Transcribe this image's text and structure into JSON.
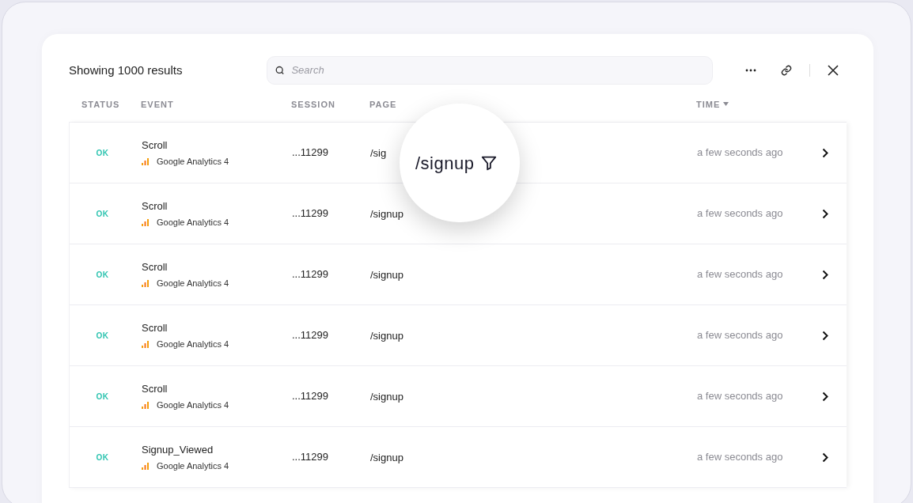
{
  "header": {
    "title": "Showing 1000 results",
    "search": {
      "placeholder": "Search"
    }
  },
  "columns": [
    {
      "label": "STATUS",
      "sorted": false
    },
    {
      "label": "EVENT",
      "sorted": false
    },
    {
      "label": "SESSION",
      "sorted": false
    },
    {
      "label": "PAGE",
      "sorted": false
    },
    {
      "label": "TIME",
      "sorted": true
    }
  ],
  "rows": [
    {
      "status": {
        "label": "OK",
        "kind": "ok"
      },
      "event": "Scroll",
      "source": "Google Analytics 4",
      "session": "...11299",
      "page": "/sig",
      "time": "a few seconds ago"
    },
    {
      "status": {
        "label": "OK",
        "kind": "ok"
      },
      "event": "Scroll",
      "source": "Google Analytics 4",
      "session": "...11299",
      "page": "/signup",
      "time": "a few seconds ago"
    },
    {
      "status": {
        "label": "OK",
        "kind": "ok"
      },
      "event": "Scroll",
      "source": "Google Analytics 4",
      "session": "...11299",
      "page": "/signup",
      "time": "a few seconds ago"
    },
    {
      "status": {
        "label": "OK",
        "kind": "ok"
      },
      "event": "Scroll",
      "source": "Google Analytics 4",
      "session": "...11299",
      "page": "/signup",
      "time": "a few seconds ago"
    },
    {
      "status": {
        "label": "OK",
        "kind": "ok"
      },
      "event": "Scroll",
      "source": "Google Analytics 4",
      "session": "...11299",
      "page": "/signup",
      "time": "a few seconds ago"
    },
    {
      "status": {
        "label": "OK",
        "kind": "ok"
      },
      "event": "Signup_Viewed",
      "source": "Google Analytics 4",
      "session": "...11299",
      "page": "/signup",
      "time": "a few seconds ago"
    }
  ],
  "magnifier": {
    "text": "/signup"
  }
}
